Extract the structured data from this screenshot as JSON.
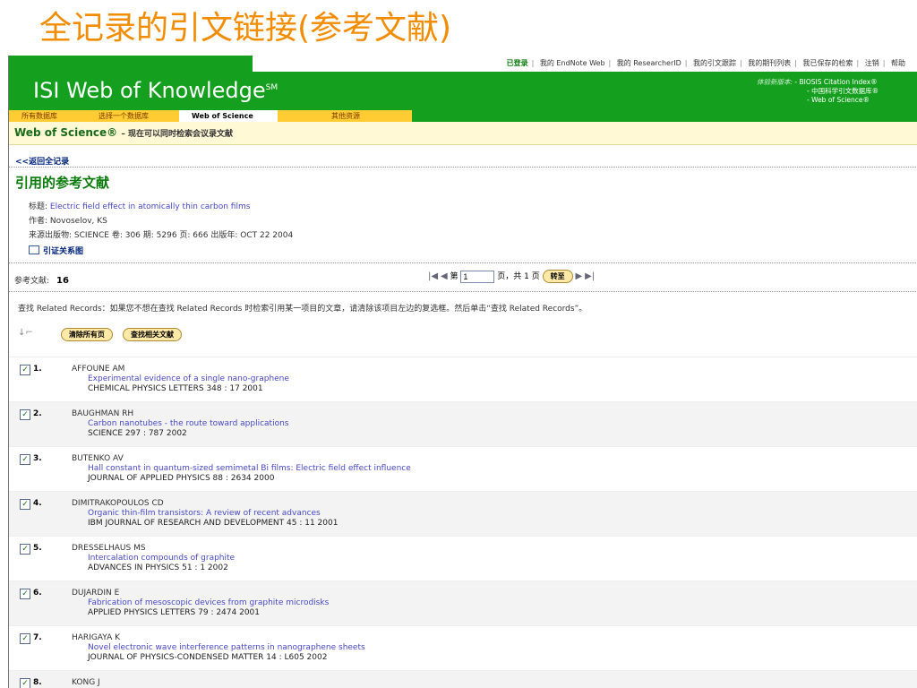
{
  "slide_title": "全记录的引文链接(参考文献)",
  "header": {
    "top_links": [
      "已登录",
      "我的 EndNote Web",
      "我的 ResearcherID",
      "我的引文跟踪",
      "我的期刊列表",
      "我已保存的检索",
      "注销",
      "帮助"
    ],
    "logo": "ISI Web of Knowledge",
    "logo_mark": "SM",
    "new_db_label": "体验新版本:",
    "new_db_items": [
      "- BIOSIS Citation Index®",
      "- 中国科学引文数据库®",
      "- Web of Science®"
    ],
    "tabs": [
      "所有数据库",
      "选择一个数据库",
      "Web of Science",
      "其他资源"
    ],
    "active_tab": 2
  },
  "subbar": {
    "product": "Web of Science®",
    "tagline": "– 现在可以同时检索会议录文献"
  },
  "back_link": "<<返回全记录",
  "heading": "引用的参考文献",
  "meta": {
    "title_label": "标题:",
    "title_value": "Electric field effect in atomically thin carbon films",
    "author_label": "作者:",
    "author_value": "Novoselov, KS",
    "source_label": "来源出版物:",
    "source_value": "SCIENCE 卷: 306 期: 5296 页: 666 出版年: OCT 22 2004",
    "citation_map": "引证关系图"
  },
  "refs_label": "参考文献:",
  "refs_count": "16",
  "pager": {
    "prefix": "第",
    "page": "1",
    "suffix": "页，共 1 页",
    "go": "转至"
  },
  "related_text": "查找 Related Records：如果您不想在查找 Related Records 时检索引用某一项目的文章，请清除该项目左边的复选框。然后单击“查找 Related Records”。",
  "tools": {
    "clear": "清除所有页",
    "find_related": "查找相关文献"
  },
  "records": [
    {
      "num": "1.",
      "author": "AFFOUNE AM",
      "title": "Experimental evidence of a single nano-graphene",
      "source": "CHEMICAL PHYSICS LETTERS 348 : 17 2001"
    },
    {
      "num": "2.",
      "author": "BAUGHMAN RH",
      "title": "Carbon nanotubes - the route toward applications",
      "source": "SCIENCE 297 : 787 2002"
    },
    {
      "num": "3.",
      "author": "BUTENKO AV",
      "title": "Hall constant in quantum-sized semimetal Bi films: Electric field effect influence",
      "source": "JOURNAL OF APPLIED PHYSICS 88 : 2634 2000"
    },
    {
      "num": "4.",
      "author": "DIMITRAKOPOULOS CD",
      "title": "Organic thin-film transistors: A review of recent advances",
      "source": "IBM JOURNAL OF RESEARCH AND DEVELOPMENT 45 : 11 2001"
    },
    {
      "num": "5.",
      "author": "DRESSELHAUS MS",
      "title": "Intercalation compounds of graphite",
      "source": "ADVANCES IN PHYSICS 51 : 1 2002"
    },
    {
      "num": "6.",
      "author": "DUJARDIN E",
      "title": "Fabrication of mesoscopic devices from graphite microdisks",
      "source": "APPLIED PHYSICS LETTERS 79 : 2474 2001"
    },
    {
      "num": "7.",
      "author": "HARIGAYA K",
      "title": "Novel electronic wave interference patterns in nanographene sheets",
      "source": "JOURNAL OF PHYSICS-CONDENSED MATTER 14 : L605 2002"
    },
    {
      "num": "8.",
      "author": "KONG J",
      "title": "",
      "source": ""
    }
  ]
}
